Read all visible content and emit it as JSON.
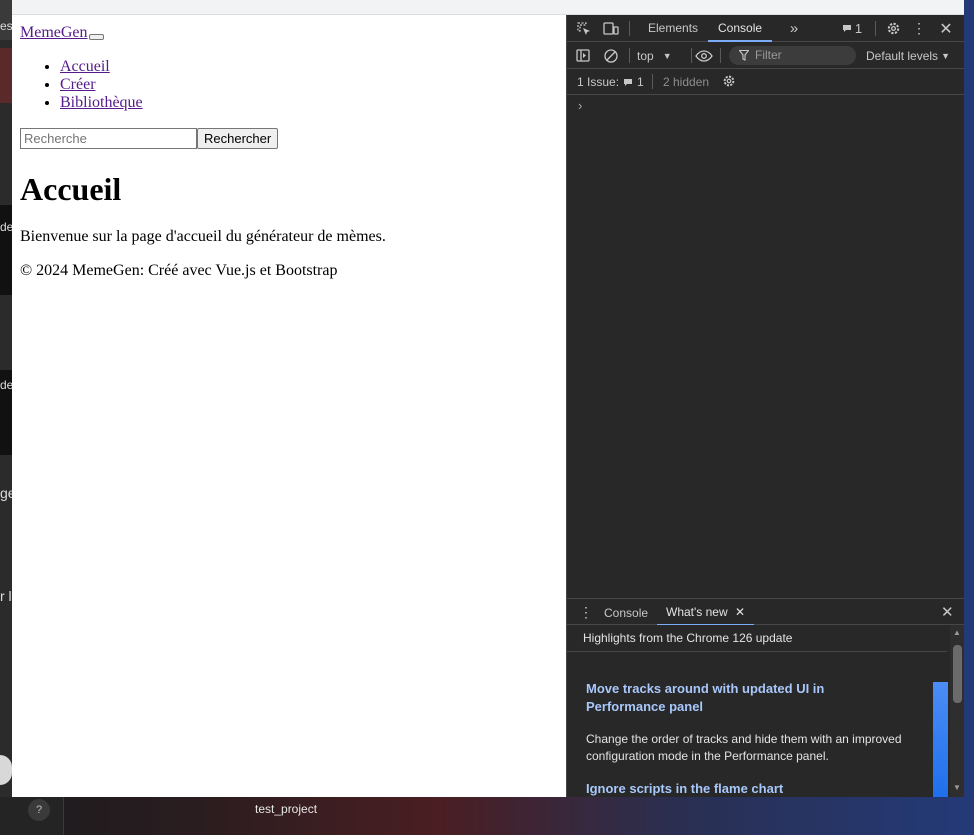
{
  "taskbar": {
    "project_label": "test_project",
    "help_glyph": "?"
  },
  "background_fragments": [
    "es",
    "de",
    "de",
    "ge",
    "r l"
  ],
  "page": {
    "brand": "MemeGen",
    "nav": [
      "Accueil",
      "Créer",
      "Bibliothèque"
    ],
    "search": {
      "placeholder": "Recherche",
      "button": "Rechercher"
    },
    "heading": "Accueil",
    "welcome": "Bienvenue sur la page d'accueil du générateur de mèmes.",
    "footer": "© 2024 MemeGen: Créé avec Vue.js et Bootstrap"
  },
  "devtools": {
    "tabs": [
      "Elements",
      "Console"
    ],
    "active_tab": "Console",
    "more_tabs_glyph": "»",
    "issue_badge_count": "1",
    "context": "top",
    "filter_placeholder": "Filter",
    "levels": "Default levels",
    "issues": {
      "label": "1 Issue:",
      "count": "1",
      "hidden": "2 hidden"
    },
    "prompt": "›",
    "drawer": {
      "tabs": [
        "Console",
        "What's new"
      ],
      "active_tab": "What's new",
      "highlights": "Highlights from the Chrome 126 update",
      "items": [
        {
          "title": "Move tracks around with updated UI in Performance panel",
          "body": "Change the order of tracks and hide them with an improved configuration mode in the Performance panel."
        },
        {
          "title": "Ignore scripts in the flame chart"
        }
      ]
    },
    "colors": {
      "background": "#282828",
      "accent": "#7cacf8",
      "link_title": "#a8c7fa"
    }
  }
}
